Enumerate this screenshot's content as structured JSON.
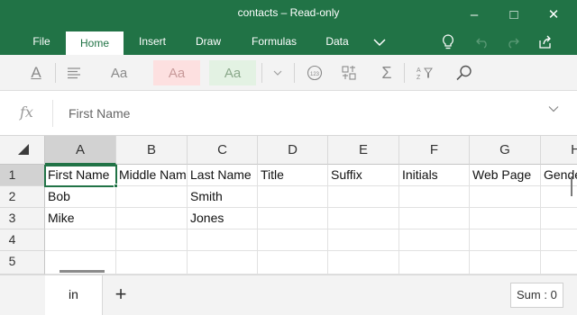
{
  "window": {
    "title": "contacts – Read-only",
    "minimize_glyph": "–",
    "maximize_glyph": "□",
    "close_glyph": "✕"
  },
  "ribbon": {
    "tabs": [
      {
        "label": "File"
      },
      {
        "label": "Home",
        "active": true
      },
      {
        "label": "Insert"
      },
      {
        "label": "Draw"
      },
      {
        "label": "Formulas"
      },
      {
        "label": "Data"
      }
    ],
    "icons": [
      "chevron-down-icon",
      "lightbulb-icon",
      "undo-icon",
      "redo-icon",
      "share-icon"
    ]
  },
  "toolbar": {
    "font_color_label": "A",
    "cell_style_labels": [
      "Aa",
      "Aa",
      "Aa"
    ],
    "icons": [
      "font-color-icon",
      "align-icon",
      "dropdown-icon",
      "number-format-icon",
      "text-convert-icon",
      "autosum-icon",
      "sort-filter-icon",
      "search-icon"
    ],
    "colors": {
      "bad_style_bg": "#fde0e0",
      "good_style_bg": "#e3f2e3"
    }
  },
  "formula_bar": {
    "fx_label": "fx",
    "value": "First Name"
  },
  "grid": {
    "columns": [
      "A",
      "B",
      "C",
      "D",
      "E",
      "F",
      "G",
      "H"
    ],
    "rows": [
      "1",
      "2",
      "3",
      "4",
      "5"
    ],
    "cells": [
      [
        "First Name",
        "Middle Name",
        "Last Name",
        "Title",
        "Suffix",
        "Initials",
        "Web Page",
        "Gender"
      ],
      [
        "Bob",
        "",
        "Smith",
        "",
        "",
        "",
        "",
        ""
      ],
      [
        "Mike",
        "",
        "Jones",
        "",
        "",
        "",
        "",
        ""
      ],
      [
        "",
        "",
        "",
        "",
        "",
        "",
        "",
        ""
      ],
      [
        "",
        "",
        "",
        "",
        "",
        "",
        "",
        ""
      ]
    ],
    "active_cell": "A1"
  },
  "sheets": {
    "tabs": [
      "in"
    ],
    "add_label": "+"
  },
  "status": {
    "sum_label": "Sum : 0"
  },
  "colors": {
    "accent": "#217346"
  }
}
